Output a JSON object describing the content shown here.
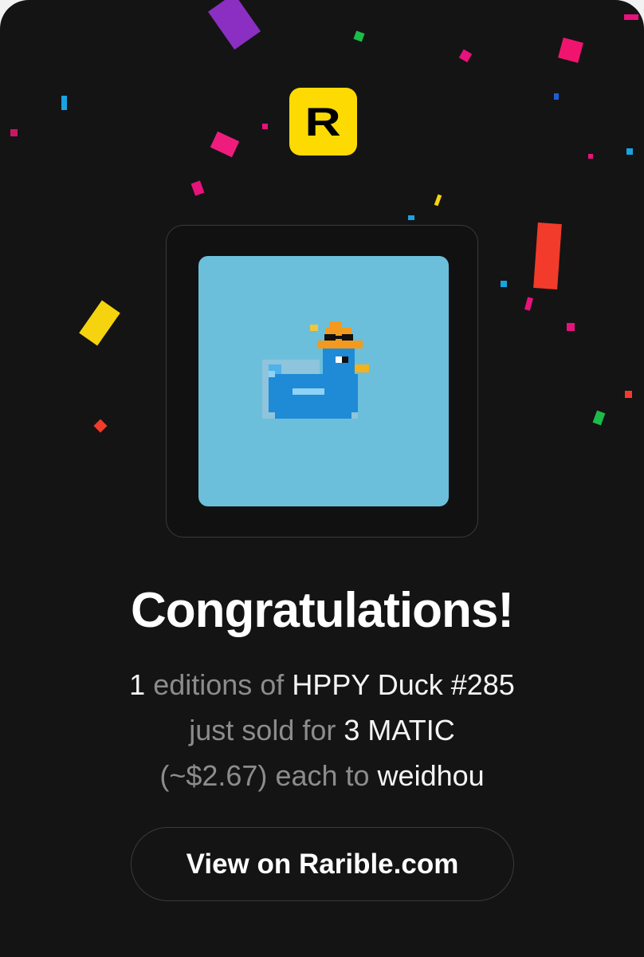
{
  "brand": {
    "logo_letter": "R",
    "logo_color": "#FEDA03"
  },
  "headline": "Congratulations!",
  "sale": {
    "quantity": "1",
    "editions_text": "editions of",
    "item_name": "HPPY Duck #285",
    "sold_text": "just sold for",
    "price": "3 MATIC",
    "usd_price": "(~$2.67)",
    "each_to_text": "each to",
    "buyer": "weidhou"
  },
  "cta": {
    "label": "View on Rarible.com"
  },
  "colors": {
    "background": "#141414",
    "artwork_background": "#6BBFDB",
    "text_primary": "#F4F4F4",
    "text_muted": "#8C8C8C"
  },
  "icons": [
    "confetti",
    "rarible-logo",
    "pixel-duck-artwork"
  ]
}
